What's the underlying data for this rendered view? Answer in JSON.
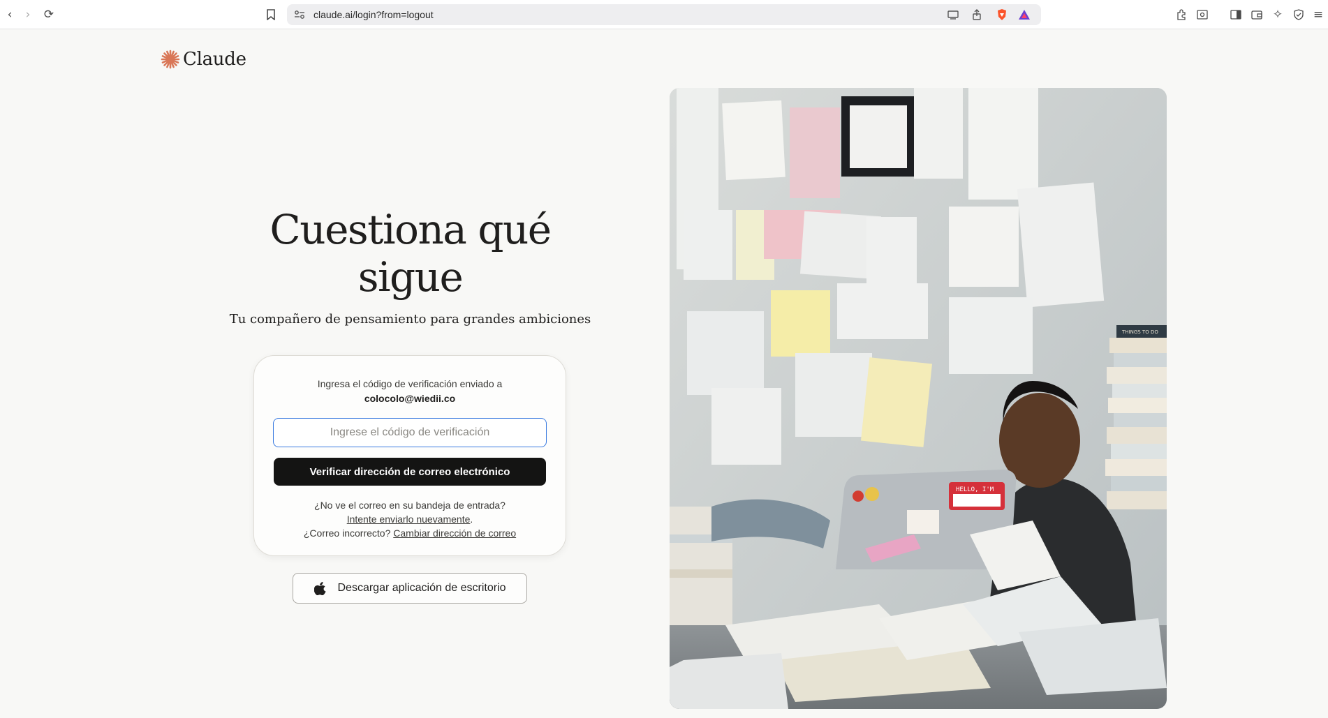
{
  "browser": {
    "url": "claude.ai/login?from=logout"
  },
  "brand": {
    "name": "Claude",
    "accent": "#d97757"
  },
  "hero": {
    "title": "Cuestiona qué sigue",
    "subtitle": "Tu compañero de pensamiento para grandes ambiciones"
  },
  "verify": {
    "message": "Ingresa el código de verificación enviado a",
    "email": "colocolo@wiedii.co",
    "placeholder": "Ingrese el código de verificación",
    "button_label": "Verificar dirección de correo electrónico",
    "no_email_text": "¿No ve el correo en su bandeja de entrada?",
    "resend_link": "Intente enviarlo nuevamente",
    "resend_suffix": ".",
    "wrong_email_text": "¿Correo incorrecto?",
    "change_email_link": "Cambiar dirección de correo"
  },
  "download": {
    "label": "Descargar aplicación de escritorio",
    "icon": "apple-icon"
  },
  "photo_notes": {
    "sticker_hello": "HELLO, I'M",
    "book_label": "THINGS TO DO"
  }
}
